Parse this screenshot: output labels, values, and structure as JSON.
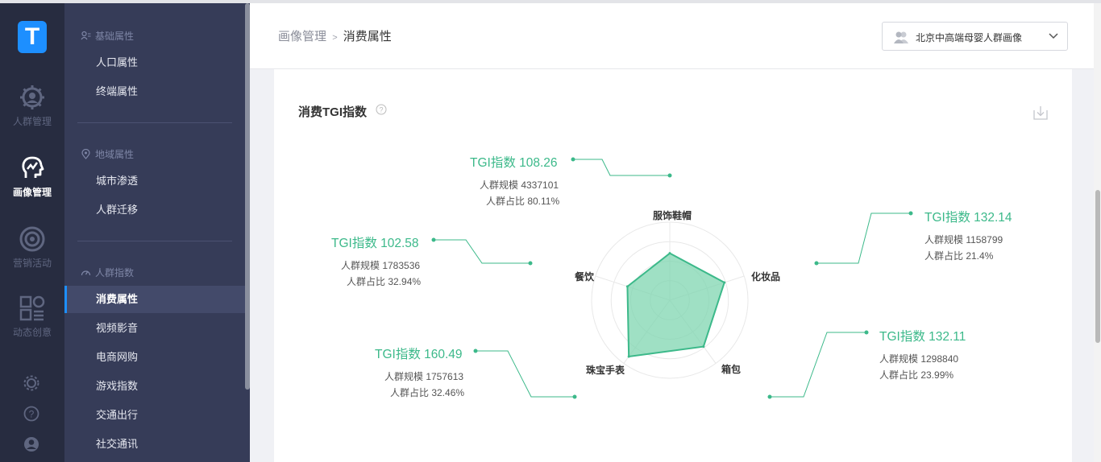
{
  "app": {
    "logo_letter": "T"
  },
  "rail": {
    "items": [
      {
        "label": "人群管理",
        "icon": "gear-icon"
      },
      {
        "label": "画像管理",
        "icon": "profile-head-icon"
      },
      {
        "label": "营销活动",
        "icon": "target-icon"
      },
      {
        "label": "动态创意",
        "icon": "shapes-icon"
      }
    ],
    "bottom_icons": [
      "settings-icon",
      "help-icon",
      "user-icon"
    ]
  },
  "menu": {
    "groups": [
      {
        "title": "基础属性",
        "items": [
          "人口属性",
          "终端属性"
        ]
      },
      {
        "title": "地域属性",
        "items": [
          "城市渗透",
          "人群迁移"
        ]
      },
      {
        "title": "人群指数",
        "items": [
          "消费属性",
          "视频影音",
          "电商网购",
          "游戏指数",
          "交通出行",
          "社交通讯"
        ]
      }
    ],
    "active_item": "消费属性"
  },
  "header": {
    "breadcrumb_parent": "画像管理",
    "breadcrumb_sep": ">",
    "breadcrumb_current": "消费属性",
    "audience_select": "北京中高端母婴人群画像"
  },
  "card": {
    "title": "消费TGI指数"
  },
  "chart_data": {
    "type": "radar",
    "axes": [
      "服饰鞋帽",
      "化妆品",
      "箱包",
      "珠宝手表",
      "餐饮"
    ],
    "values": [
      108.26,
      132.14,
      132.11,
      160.49,
      102.58
    ],
    "callouts": [
      {
        "axis": "服饰鞋帽",
        "tgi": "TGI指数 108.26",
        "scale": "人群规模 4337101",
        "ratio": "人群占比 80.11%"
      },
      {
        "axis": "化妆品",
        "tgi": "TGI指数 132.14",
        "scale": "人群规模 1158799",
        "ratio": "人群占比 21.4%"
      },
      {
        "axis": "箱包",
        "tgi": "TGI指数 132.11",
        "scale": "人群规模 1298840",
        "ratio": "人群占比 23.99%"
      },
      {
        "axis": "珠宝手表",
        "tgi": "TGI指数 160.49",
        "scale": "人群规模 1757613",
        "ratio": "人群占比 32.46%"
      },
      {
        "axis": "餐饮",
        "tgi": "TGI指数 102.58",
        "scale": "人群规模 1783536",
        "ratio": "人群占比 32.94%"
      }
    ],
    "color": "#3cb98a",
    "fill": "#7fd6b0"
  }
}
